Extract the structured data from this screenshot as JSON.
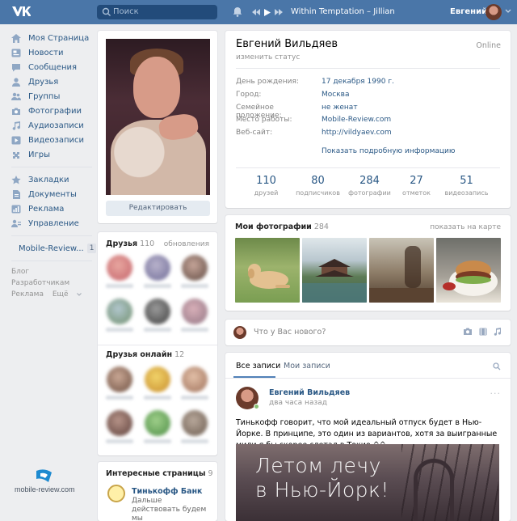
{
  "header": {
    "search_placeholder": "Поиск",
    "track": "Within Temptation – Jillian",
    "user_name": "Евгений"
  },
  "sidebar": {
    "items": [
      {
        "label": "Моя Страница",
        "icon": "home-icon"
      },
      {
        "label": "Новости",
        "icon": "news-icon"
      },
      {
        "label": "Сообщения",
        "icon": "messages-icon"
      },
      {
        "label": "Друзья",
        "icon": "friends-icon"
      },
      {
        "label": "Группы",
        "icon": "groups-icon"
      },
      {
        "label": "Фотографии",
        "icon": "camera-icon"
      },
      {
        "label": "Аудиозаписи",
        "icon": "music-icon"
      },
      {
        "label": "Видеозаписи",
        "icon": "video-icon"
      },
      {
        "label": "Игры",
        "icon": "games-icon"
      }
    ],
    "items2": [
      {
        "label": "Закладки",
        "icon": "star-icon"
      },
      {
        "label": "Документы",
        "icon": "document-icon"
      },
      {
        "label": "Реклама",
        "icon": "ads-icon"
      },
      {
        "label": "Управление",
        "icon": "manage-icon"
      }
    ],
    "community": {
      "label": "Mobile-Review...",
      "badge": "1"
    },
    "footer_links": [
      "Блог",
      "Разработчикам",
      "Реклама",
      "Ещё"
    ]
  },
  "profile_photo": {
    "edit_label": "Редактировать"
  },
  "friends": {
    "title": "Друзья",
    "count": "110",
    "link": "обновления"
  },
  "friends_online": {
    "title": "Друзья онлайн",
    "count": "12"
  },
  "interesting": {
    "title": "Интересные страницы",
    "count": "9",
    "page_name": "Тинькофф Банк",
    "page_desc": "Дальше действовать будем мы"
  },
  "profile": {
    "name": "Евгений Вильдяев",
    "status": "изменить статус",
    "online": "Online",
    "rows": [
      {
        "key": "День рождения:",
        "value": "17 декабря 1990 г."
      },
      {
        "key": "Город:",
        "value": "Москва"
      },
      {
        "key": "Семейное положение:",
        "value": "не женат"
      },
      {
        "key": "Место работы:",
        "value": "Mobile-Review.com"
      },
      {
        "key": "Веб-сайт:",
        "value": "http://vildyaev.com"
      }
    ],
    "more": "Показать подробную информацию",
    "counters": [
      {
        "n": "110",
        "label": "друзей"
      },
      {
        "n": "80",
        "label": "подписчиков"
      },
      {
        "n": "284",
        "label": "фотографии"
      },
      {
        "n": "27",
        "label": "отметок"
      },
      {
        "n": "51",
        "label": "видеозапись"
      }
    ]
  },
  "photos": {
    "title": "Мои фотографии",
    "count": "284",
    "map_link": "показать на карте"
  },
  "post_form": {
    "placeholder": "Что у Вас нового?"
  },
  "wall": {
    "tab_all": "Все записи",
    "tab_mine": "Мои записи",
    "post": {
      "author": "Евгений Вильдяев",
      "time": "два часа назад",
      "menu": "···",
      "text": "Тинькофф говорит, что мой идеальный отпуск будет в Нью-Йорке. В принципе, это один из вариантов, хотя за выигранные мили я бы скорее слетал в Токио ^^",
      "image_text_1": "Летом лечу",
      "image_text_2": "в Нью-Йорк!"
    }
  },
  "watermark": {
    "text": "mobile-review.com"
  },
  "colors": {
    "header": "#4a76a8",
    "link": "#2a5885",
    "background": "#edeef0"
  }
}
